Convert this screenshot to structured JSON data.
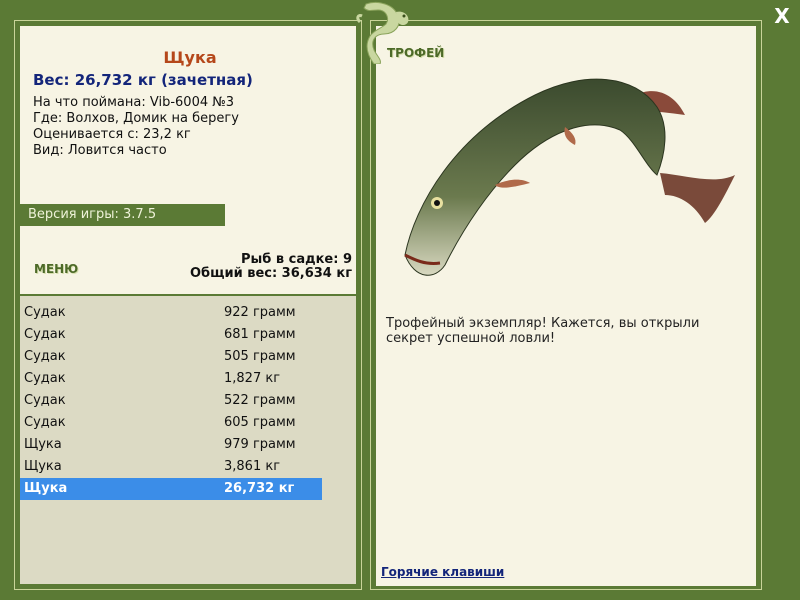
{
  "fish": {
    "title": "Щука",
    "weight": "Вес: 26,732 кг (зачетная)",
    "bait": "На что поймана: Vib-6004 №3",
    "where": "Где: Волхов, Домик на берегу",
    "estimated": "Оценивается с: 23,2 кг",
    "kind": "Вид: Ловится часто"
  },
  "version": "Версия игры: 3.7.5",
  "menu_label": "МЕНЮ",
  "stats": {
    "fish_in_keepnet": "Рыб в садке: 9",
    "total_weight": "Общий вес: 36,634 кг"
  },
  "catches": [
    {
      "name": "Судак",
      "weight": "922 грамм"
    },
    {
      "name": "Судак",
      "weight": "681 грамм"
    },
    {
      "name": "Судак",
      "weight": "505 грамм"
    },
    {
      "name": "Судак",
      "weight": "1,827 кг"
    },
    {
      "name": "Судак",
      "weight": "522 грамм"
    },
    {
      "name": "Судак",
      "weight": "605 грамм"
    },
    {
      "name": "Щука",
      "weight": "979 грамм"
    },
    {
      "name": "Щука",
      "weight": "3,861 кг"
    },
    {
      "name": "Щука",
      "weight": "26,732 кг",
      "selected": true
    }
  ],
  "trophy_label": "ТРОФЕЙ",
  "trophy_text": "Трофейный экземпляр! Кажется, вы открыли секрет успешной ловли!",
  "hotkeys": "Горячие клавиши",
  "close_label": "X",
  "colors": {
    "background": "#5b7a35",
    "panel": "#f7f4e4",
    "list_bg": "#dcdac4",
    "selection": "#3b8de8",
    "title": "#b5471a",
    "weight": "#13257a"
  }
}
